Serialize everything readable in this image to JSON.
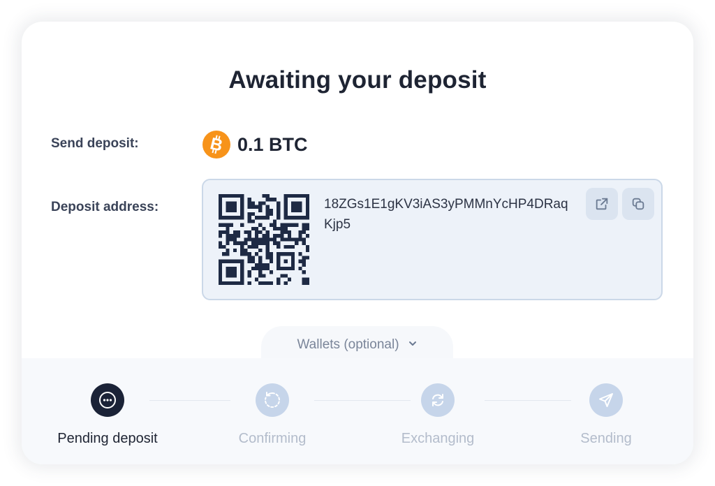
{
  "title": "Awaiting your deposit",
  "send": {
    "label": "Send deposit:",
    "amount": "0.1 BTC",
    "coin_icon": "bitcoin-icon",
    "coin_color": "#f7931a"
  },
  "deposit": {
    "label": "Deposit address:",
    "address": "18ZGs1E1gKV3iAS3yPMMnYcHP4DRaqKjp5",
    "open_icon": "external-link-icon",
    "copy_icon": "copy-icon"
  },
  "wallets": {
    "label": "Wallets (optional)",
    "icon": "chevron-down-icon"
  },
  "steps": [
    {
      "label": "Pending deposit",
      "icon": "more-dots-icon",
      "active": true
    },
    {
      "label": "Confirming",
      "icon": "refresh-icon",
      "active": false
    },
    {
      "label": "Exchanging",
      "icon": "exchange-icon",
      "active": false
    },
    {
      "label": "Sending",
      "icon": "send-icon",
      "active": false
    }
  ],
  "colors": {
    "accent_dark": "#1b2337",
    "inactive_step": "#c6d5ea",
    "address_box": "#edf2f9"
  }
}
